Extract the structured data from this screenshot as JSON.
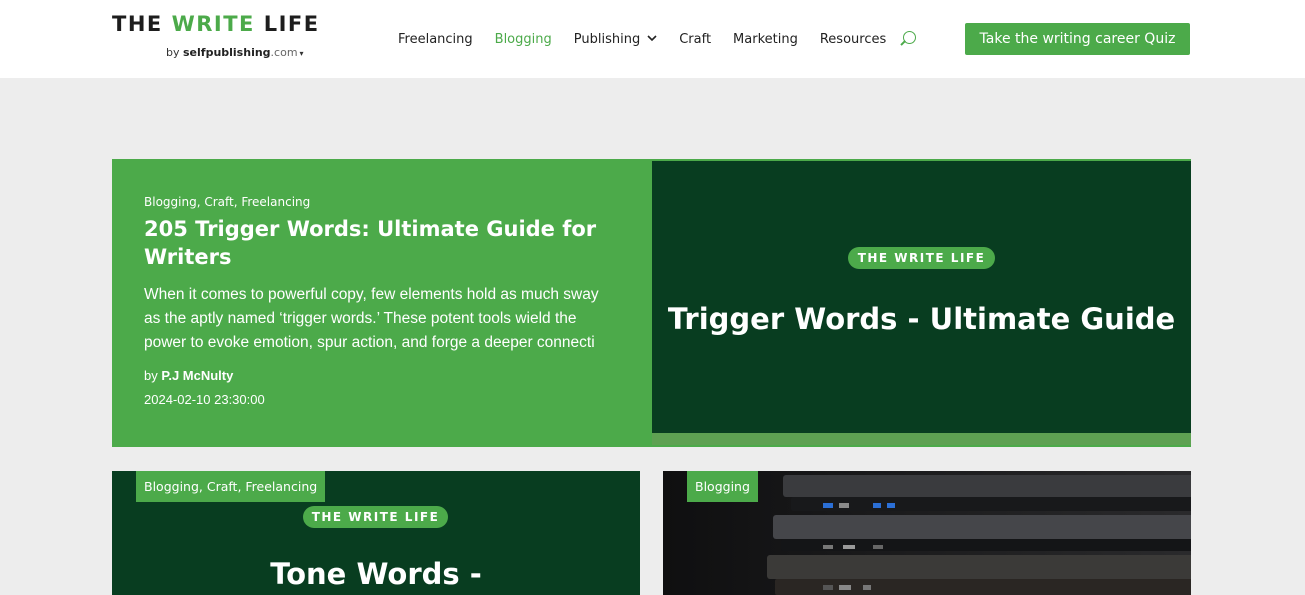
{
  "header": {
    "logo": {
      "part1": "THE ",
      "part2": "WRITE",
      "part3": " LIFE",
      "by_prefix": "by ",
      "by_brand": "selfpublishing",
      "by_suffix": ".com",
      "caret": "▾"
    },
    "nav": [
      {
        "label": "Freelancing",
        "active": false
      },
      {
        "label": "Blogging",
        "active": true
      },
      {
        "label": "Publishing",
        "active": false,
        "dropdown": true
      },
      {
        "label": "Craft",
        "active": false
      },
      {
        "label": "Marketing",
        "active": false
      },
      {
        "label": "Resources",
        "active": false
      }
    ],
    "chevron": "⌄",
    "search_icon": "search-icon",
    "cta_label": "Take the writing career Quiz"
  },
  "featured": {
    "categories": "Blogging, Craft, Freelancing",
    "title": "205 Trigger Words: Ultimate Guide for Writers",
    "excerpt": "When it comes to powerful copy, few elements hold as much sway as the aptly named ‘trigger words.’ These potent tools wield the power to evoke emotion, spur action, and forge a deeper connecti",
    "author_prefix": "by ",
    "author": "P.J McNulty",
    "date": "2024-02-10 23:30:00",
    "image": {
      "badge": "THE WRITE LIFE",
      "title": "Trigger Words - Ultimate Guide"
    }
  },
  "cards": [
    {
      "tag": "Blogging, Craft, Freelancing",
      "image_badge": "THE WRITE LIFE",
      "image_title": "Tone Words -"
    },
    {
      "tag": "Blogging",
      "image": "laptop-stack-photo"
    }
  ],
  "colors": {
    "brand_green": "#4caa4a",
    "dark_green": "#083d20",
    "page_bg": "#ededed"
  }
}
